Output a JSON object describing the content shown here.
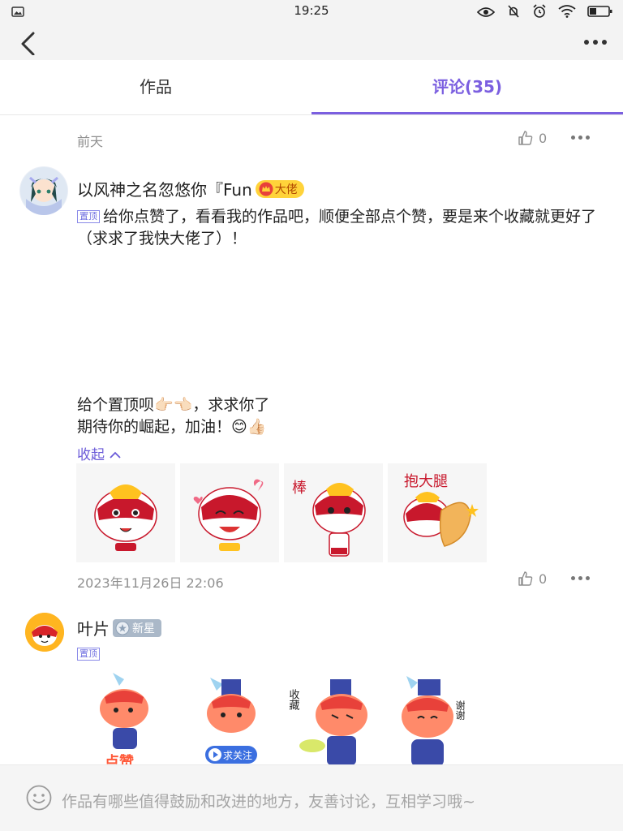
{
  "status_bar": {
    "time": "19:25"
  },
  "nav": {
    "back_icon": "back-arrow-icon",
    "more_icon": "more-dots-icon"
  },
  "tabs": [
    {
      "label": "作品",
      "active": false
    },
    {
      "label": "评论(35)",
      "active": true
    }
  ],
  "top_row": {
    "date": "前天",
    "like_count": "0"
  },
  "comments": [
    {
      "username": "以风神之名忽悠你『Fun",
      "badge": "大佬",
      "pin_label": "置顶",
      "text": "给你点赞了，看看我的作品吧，顺便全部点个赞，要是来个收藏就更好了（求求了我快大佬了）！",
      "text2_line1": "给个置顶呗👉🏻👈🏻，求求你了",
      "text2_line2": "期待你的崛起，加油！😊👍🏻",
      "collapse_label": "收起",
      "sticker_texts": [
        "",
        "",
        "棒",
        "抱大腿"
      ],
      "timestamp": "2023年11月26日 22:06",
      "like_count": "0"
    },
    {
      "username": "叶片",
      "badge": "新星",
      "pin_label": "置顶",
      "sticker_texts": [
        "点赞",
        "求关注",
        "收藏",
        "谢谢"
      ]
    }
  ],
  "input": {
    "placeholder": "作品有哪些值得鼓励和改进的地方，友善讨论，互相学习哦~",
    "emoji_icon": "smile-icon"
  },
  "colors": {
    "accent": "#7b5fe0",
    "badge_gold": "#ffd33a",
    "badge_silver": "#aab8c8",
    "sticker_red": "#c8182c"
  }
}
